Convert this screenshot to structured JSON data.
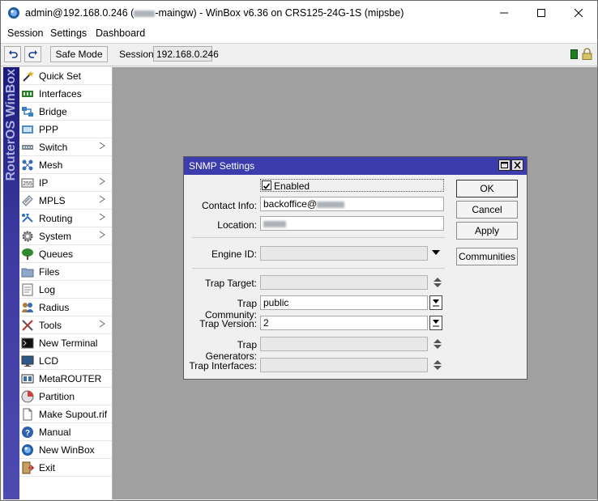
{
  "window": {
    "title_prefix": "admin@192.168.0.246 (",
    "title_suffix": "-maingw) - WinBox v6.36 on CRS125-24G-1S (mipsbe)"
  },
  "menu": [
    "Session",
    "Settings",
    "Dashboard"
  ],
  "toolbar": {
    "safe_mode_label": "Safe Mode",
    "session_label": "Session:",
    "session_value": "192.168.0.246"
  },
  "sidebar": {
    "brand": "RouterOS WinBox",
    "items": [
      {
        "label": "Quick Set",
        "icon": "wand-icon",
        "submenu": false
      },
      {
        "label": "Interfaces",
        "icon": "interfaces-icon",
        "submenu": false
      },
      {
        "label": "Bridge",
        "icon": "bridge-icon",
        "submenu": false
      },
      {
        "label": "PPP",
        "icon": "ppp-icon",
        "submenu": false
      },
      {
        "label": "Switch",
        "icon": "switch-icon",
        "submenu": true
      },
      {
        "label": "Mesh",
        "icon": "mesh-icon",
        "submenu": false
      },
      {
        "label": "IP",
        "icon": "ip-icon",
        "submenu": true
      },
      {
        "label": "MPLS",
        "icon": "mpls-icon",
        "submenu": true
      },
      {
        "label": "Routing",
        "icon": "routing-icon",
        "submenu": true
      },
      {
        "label": "System",
        "icon": "gear-icon",
        "submenu": true
      },
      {
        "label": "Queues",
        "icon": "queues-icon",
        "submenu": false
      },
      {
        "label": "Files",
        "icon": "folder-icon",
        "submenu": false
      },
      {
        "label": "Log",
        "icon": "log-icon",
        "submenu": false
      },
      {
        "label": "Radius",
        "icon": "radius-icon",
        "submenu": false
      },
      {
        "label": "Tools",
        "icon": "tools-icon",
        "submenu": true
      },
      {
        "label": "New Terminal",
        "icon": "terminal-icon",
        "submenu": false
      },
      {
        "label": "LCD",
        "icon": "lcd-icon",
        "submenu": false
      },
      {
        "label": "MetaROUTER",
        "icon": "metarouter-icon",
        "submenu": false
      },
      {
        "label": "Partition",
        "icon": "partition-icon",
        "submenu": false
      },
      {
        "label": "Make Supout.rif",
        "icon": "document-icon",
        "submenu": false
      },
      {
        "label": "Manual",
        "icon": "help-icon",
        "submenu": false
      },
      {
        "label": "New WinBox",
        "icon": "winbox-icon",
        "submenu": false
      },
      {
        "label": "Exit",
        "icon": "exit-icon",
        "submenu": false
      }
    ]
  },
  "dialog": {
    "title": "SNMP Settings",
    "enabled_label": "Enabled",
    "enabled": true,
    "contact_label": "Contact Info:",
    "contact_value": "backoffice@",
    "location_label": "Location:",
    "engine_id_label": "Engine ID:",
    "trap_target_label": "Trap Target:",
    "trap_community_label": "Trap Community:",
    "trap_community_value": "public",
    "trap_version_label": "Trap Version:",
    "trap_version_value": "2",
    "trap_generators_label": "Trap Generators:",
    "trap_interfaces_label": "Trap Interfaces:",
    "ok_label": "OK",
    "cancel_label": "Cancel",
    "apply_label": "Apply",
    "communities_label": "Communities"
  }
}
